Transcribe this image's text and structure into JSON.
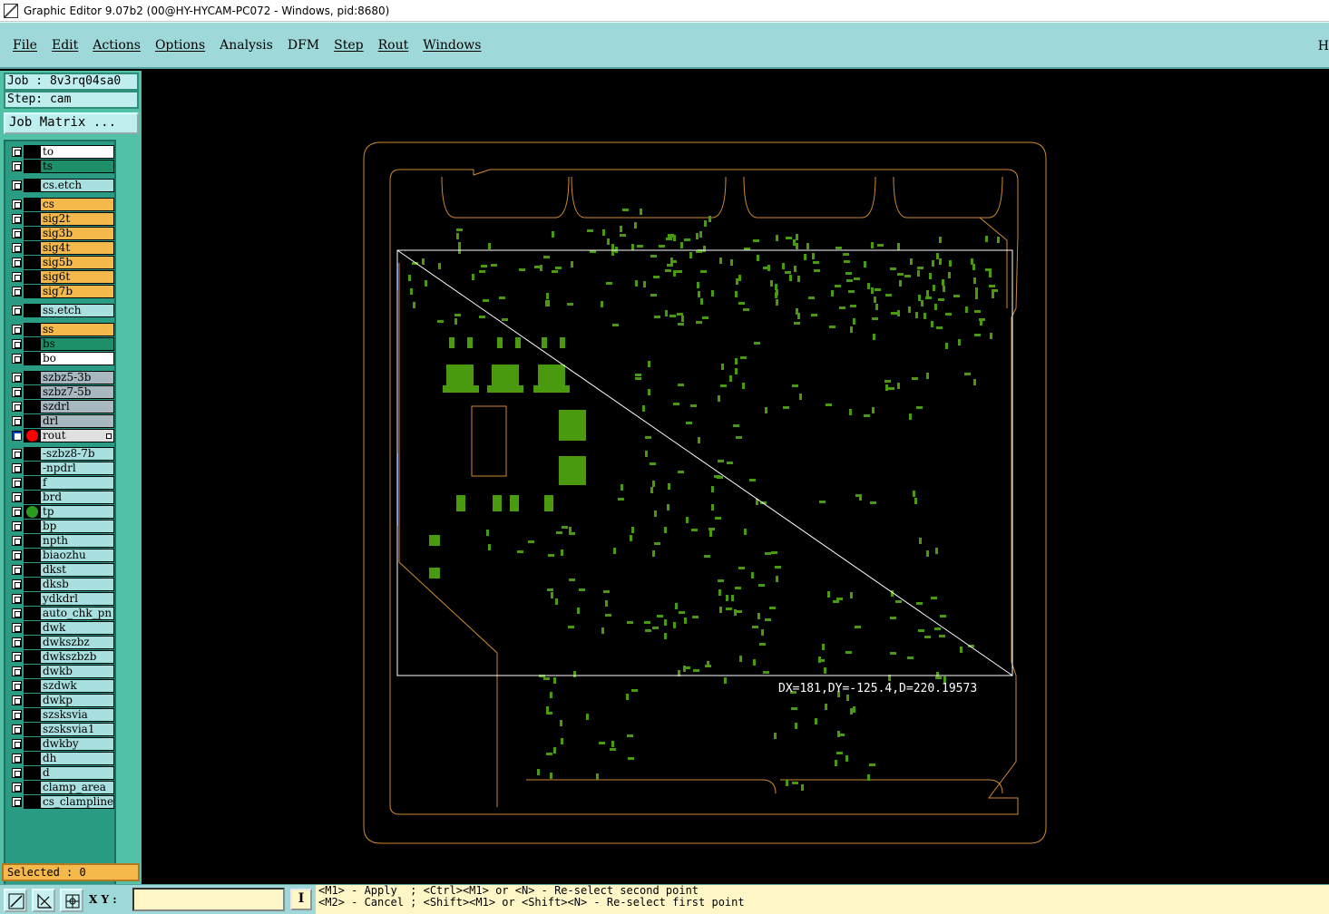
{
  "window": {
    "title": "Graphic Editor 9.07b2 (00@HY-HYCAM-PC072 - Windows, pid:8680)"
  },
  "menu": {
    "items": [
      "File",
      "Edit",
      "Actions",
      "Options",
      "Analysis",
      "DFM",
      "Step",
      "Rout",
      "Windows"
    ],
    "right_label": "H"
  },
  "sidebar": {
    "job": "Job : 8v3rq04sa0",
    "step": "Step: cam",
    "job_matrix_button": "Job Matrix ...",
    "selected": "Selected : 0",
    "layers": [
      {
        "name": "to",
        "color": "#ffffff"
      },
      {
        "name": "ts",
        "color": "#1f8f6a"
      },
      {
        "name": "cs.etch",
        "color": "#a8e0e0"
      },
      {
        "name": "cs",
        "color": "#f5b84a"
      },
      {
        "name": "sig2t",
        "color": "#f5b84a"
      },
      {
        "name": "sig3b",
        "color": "#f5b84a"
      },
      {
        "name": "sig4t",
        "color": "#f5b84a"
      },
      {
        "name": "sig5b",
        "color": "#f5b84a"
      },
      {
        "name": "sig6t",
        "color": "#f5b84a"
      },
      {
        "name": "sig7b",
        "color": "#f5b84a"
      },
      {
        "name": "ss.etch",
        "color": "#a8e0e0"
      },
      {
        "name": "ss",
        "color": "#f5b84a"
      },
      {
        "name": "bs",
        "color": "#1f8f6a"
      },
      {
        "name": "bo",
        "color": "#ffffff"
      },
      {
        "name": "szbz5-3b",
        "color": "#a8b8c0"
      },
      {
        "name": "szbz7-5b",
        "color": "#a8b8c0"
      },
      {
        "name": "szdrl",
        "color": "#a8b8c0"
      },
      {
        "name": "drl",
        "color": "#a8b8c0"
      },
      {
        "name": "rout",
        "color": "#e0e0e0",
        "active": true,
        "dot": "#ff0000"
      },
      {
        "name": "-szbz8-7b",
        "color": "#a8e0e0"
      },
      {
        "name": "-npdrl",
        "color": "#a8e0e0"
      },
      {
        "name": "f",
        "color": "#a8e0e0"
      },
      {
        "name": "brd",
        "color": "#a8e0e0"
      },
      {
        "name": "tp",
        "color": "#a8e0e0",
        "dot": "#2c9c20"
      },
      {
        "name": "bp",
        "color": "#a8e0e0"
      },
      {
        "name": "npth",
        "color": "#a8e0e0"
      },
      {
        "name": "biaozhu",
        "color": "#a8e0e0"
      },
      {
        "name": "dkst",
        "color": "#a8e0e0"
      },
      {
        "name": "dksb",
        "color": "#a8e0e0"
      },
      {
        "name": "ydkdrl",
        "color": "#a8e0e0"
      },
      {
        "name": "auto_chk_pn",
        "color": "#a8e0e0"
      },
      {
        "name": "dwk",
        "color": "#a8e0e0"
      },
      {
        "name": "dwkszbz",
        "color": "#a8e0e0"
      },
      {
        "name": "dwkszbzb",
        "color": "#a8e0e0"
      },
      {
        "name": "dwkb",
        "color": "#a8e0e0"
      },
      {
        "name": "szdwk",
        "color": "#a8e0e0"
      },
      {
        "name": "dwkp",
        "color": "#a8e0e0"
      },
      {
        "name": "szsksvia",
        "color": "#a8e0e0"
      },
      {
        "name": "szsksvia1",
        "color": "#a8e0e0"
      },
      {
        "name": "dwkby",
        "color": "#a8e0e0"
      },
      {
        "name": "dh",
        "color": "#a8e0e0"
      },
      {
        "name": "d",
        "color": "#a8e0e0"
      },
      {
        "name": "clamp_area",
        "color": "#a8e0e0"
      },
      {
        "name": "cs_clampline",
        "color": "#a8e0e0"
      }
    ]
  },
  "canvas": {
    "measure": "DX=181,DY=-125.4,D=220.19573",
    "outline_color": "#d08a30",
    "feature_color": "#4a9a10"
  },
  "bottom": {
    "xy_label": "X Y :",
    "xy_value": "",
    "info_button": "I",
    "prompt_line1": "<M1> - Apply  ; <Ctrl><M1> or <N> - Re-select second point",
    "prompt_line2": "<M2> - Cancel ; <Shift><M1> or <Shift><N> - Re-select first point"
  }
}
